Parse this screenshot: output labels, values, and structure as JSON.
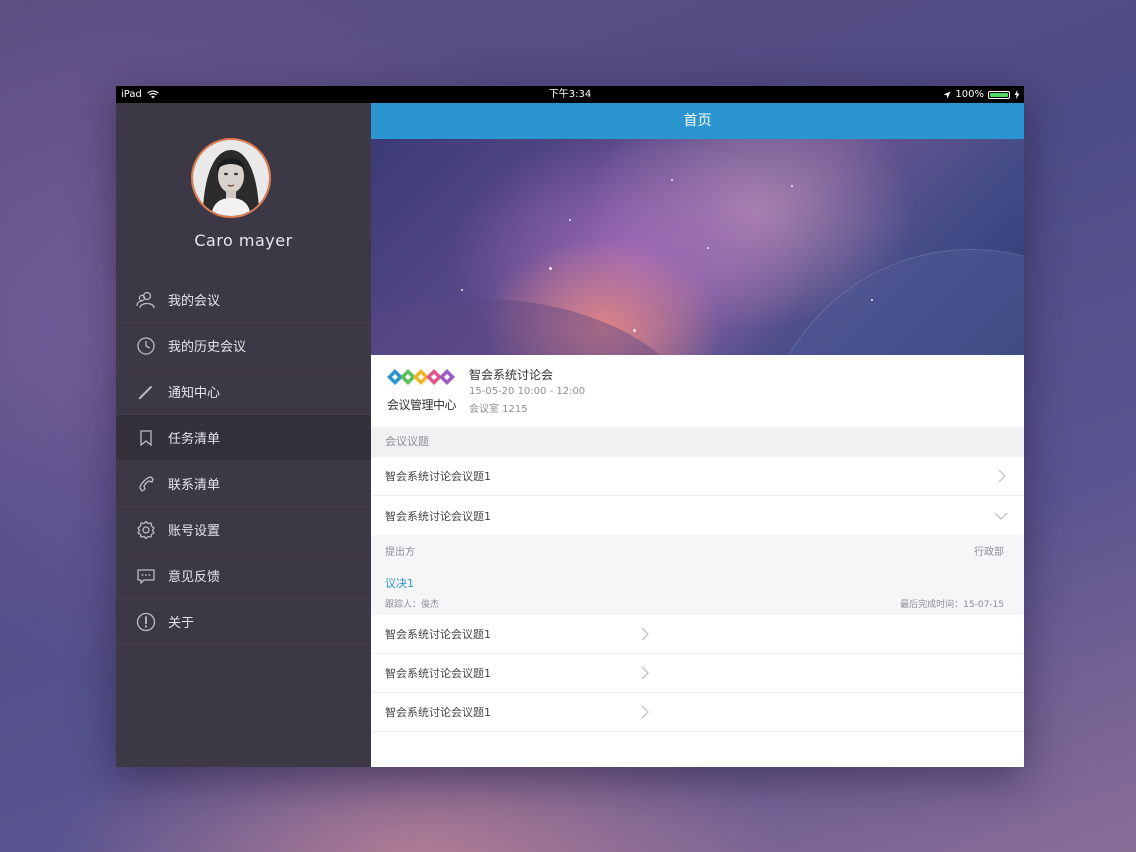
{
  "status_bar": {
    "device": "iPad",
    "time": "下午3:34",
    "battery": "100%"
  },
  "sidebar": {
    "username": "Caro mayer",
    "items": [
      {
        "label": "我的会议",
        "icon": "users-icon"
      },
      {
        "label": "我的历史会议",
        "icon": "clock-icon"
      },
      {
        "label": "通知中心",
        "icon": "pencil-icon"
      },
      {
        "label": "任务清单",
        "icon": "bookmark-icon",
        "active": true
      },
      {
        "label": "联系清单",
        "icon": "phone-icon"
      },
      {
        "label": "账号设置",
        "icon": "gear-icon"
      },
      {
        "label": "意见反馈",
        "icon": "message-icon"
      },
      {
        "label": "关于",
        "icon": "info-icon"
      }
    ]
  },
  "navbar": {
    "title": "首页"
  },
  "meeting": {
    "logo_text": "会议管理中心",
    "title": "智会系统讨论会",
    "time": "15-05-20 10:00 - 12:00",
    "room": "会议室 1215"
  },
  "agenda": {
    "header": "会议议题",
    "items": [
      {
        "label": "智会系统讨论会议题1"
      },
      {
        "label": "智会系统讨论会议题1",
        "expanded": true
      },
      {
        "label": "智会系统讨论会议题1"
      },
      {
        "label": "智会系统讨论会议题1"
      },
      {
        "label": "智会系统讨论会议题1"
      }
    ],
    "detail": {
      "proposer_label": "提出方",
      "proposer_value": "行政部",
      "resolution": "议决1",
      "tracker": "跟踪人：俊杰",
      "deadline": "最后完成时间：15-07-15"
    }
  },
  "colors": {
    "accent": "#2b95d0",
    "sidebar_bg": "#3d3845",
    "avatar_ring": "#e27b4e"
  }
}
